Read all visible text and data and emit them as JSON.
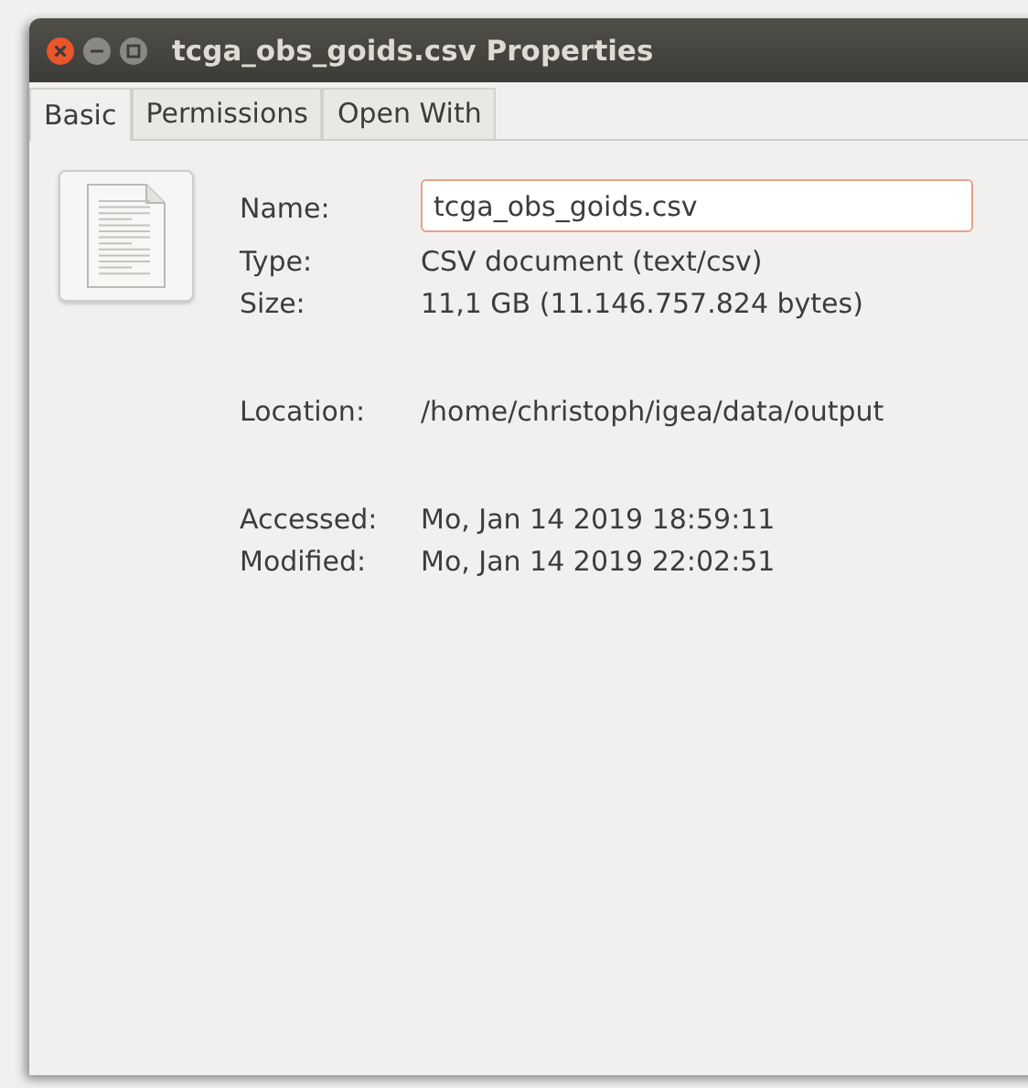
{
  "window": {
    "title": "tcga_obs_goids.csv Properties"
  },
  "tabs": [
    {
      "label": "Basic",
      "selected": true
    },
    {
      "label": "Permissions",
      "selected": false
    },
    {
      "label": "Open With",
      "selected": false
    }
  ],
  "name": {
    "label": "Name:",
    "value": "tcga_obs_goids.csv"
  },
  "groups": [
    [
      {
        "label": "Type:",
        "value": "CSV document (text/csv)"
      },
      {
        "label": "Size:",
        "value": "11,1 GB (11.146.757.824 bytes)"
      }
    ],
    [
      {
        "label": "Location:",
        "value": "/home/christoph/igea/data/output"
      }
    ],
    [
      {
        "label": "Accessed:",
        "value": "Mo, Jan 14 2019 18:59:11"
      },
      {
        "label": "Modified:",
        "value": "Mo, Jan 14 2019 22:02:51"
      }
    ]
  ]
}
